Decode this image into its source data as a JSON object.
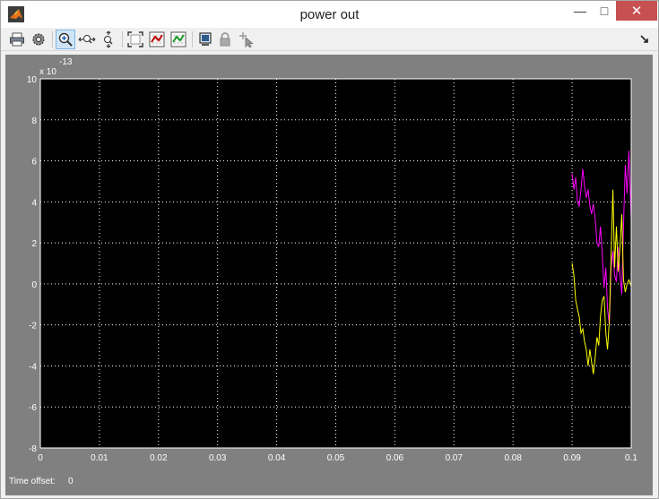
{
  "window": {
    "title": "power out",
    "close": "✕",
    "maximize": "□",
    "minimize": "—"
  },
  "toolbar": {
    "buttons": [
      "print-icon",
      "settings-icon",
      "zoom-in-icon",
      "zoom-x-icon",
      "zoom-y-icon",
      "autoscale-icon",
      "save-axes-icon",
      "restore-axes-icon",
      "float-icon",
      "lock-icon",
      "signal-selection-icon"
    ]
  },
  "status": {
    "time_offset_label": "Time offset:",
    "time_offset_value": "0"
  },
  "colors": {
    "plot_bg": "#000000",
    "frame_bg": "#808080",
    "grid": "#ffffff",
    "series1": "#ff00ff",
    "series2": "#ffff00"
  },
  "chart_data": {
    "type": "line",
    "title": "",
    "xlabel": "",
    "ylabel": "",
    "exponent_label": "x 10",
    "exponent_value": "-13",
    "xlim": [
      0,
      0.1
    ],
    "ylim": [
      -8,
      10
    ],
    "xticks": [
      "0",
      "0.01",
      "0.02",
      "0.03",
      "0.04",
      "0.05",
      "0.06",
      "0.07",
      "0.08",
      "0.09",
      "0.1"
    ],
    "yticks": [
      "-8",
      "-6",
      "-4",
      "-2",
      "0",
      "2",
      "4",
      "6",
      "8",
      "10"
    ],
    "grid": true,
    "series": [
      {
        "color": "#ff00ff",
        "x": [
          0.09,
          0.0903,
          0.0906,
          0.0909,
          0.0912,
          0.0915,
          0.0918,
          0.0921,
          0.0924,
          0.0927,
          0.093,
          0.0933,
          0.0936,
          0.0939,
          0.0942,
          0.0945,
          0.0948,
          0.0951,
          0.0954,
          0.0957,
          0.096,
          0.0963,
          0.0966,
          0.0969,
          0.0972,
          0.0975,
          0.0978,
          0.0981,
          0.0984,
          0.0987,
          0.099,
          0.0993,
          0.0996,
          0.1
        ],
        "y": [
          5.4,
          4.6,
          5.2,
          4.0,
          3.8,
          4.6,
          5.6,
          4.8,
          4.2,
          4.6,
          3.8,
          3.4,
          3.9,
          3.2,
          2.0,
          1.8,
          2.8,
          1.5,
          -0.2,
          0.8,
          -1.2,
          -2.0,
          0.8,
          1.6,
          0.4,
          0.1,
          1.8,
          0.4,
          -0.5,
          2.8,
          5.8,
          4.4,
          6.5,
          3.2
        ]
      },
      {
        "color": "#ffff00",
        "x": [
          0.09,
          0.0903,
          0.0906,
          0.0909,
          0.0912,
          0.0915,
          0.0918,
          0.0921,
          0.0924,
          0.0927,
          0.093,
          0.0933,
          0.0936,
          0.0939,
          0.0942,
          0.0945,
          0.0948,
          0.0951,
          0.0954,
          0.0957,
          0.096,
          0.0963,
          0.0966,
          0.0969,
          0.0972,
          0.0975,
          0.0978,
          0.0981,
          0.0984,
          0.0987,
          0.099,
          0.0993,
          0.0996,
          0.1
        ],
        "y": [
          1.0,
          0.4,
          -0.8,
          -1.2,
          -1.6,
          -2.4,
          -2.2,
          -2.8,
          -3.2,
          -4.0,
          -3.2,
          -3.8,
          -4.4,
          -3.6,
          -2.6,
          -3.0,
          -1.6,
          -0.8,
          -0.6,
          -2.4,
          -3.2,
          -1.8,
          1.4,
          4.6,
          0.8,
          2.8,
          0.6,
          1.8,
          3.4,
          0.2,
          -0.4,
          0.0,
          0.2,
          -0.1
        ]
      }
    ]
  }
}
